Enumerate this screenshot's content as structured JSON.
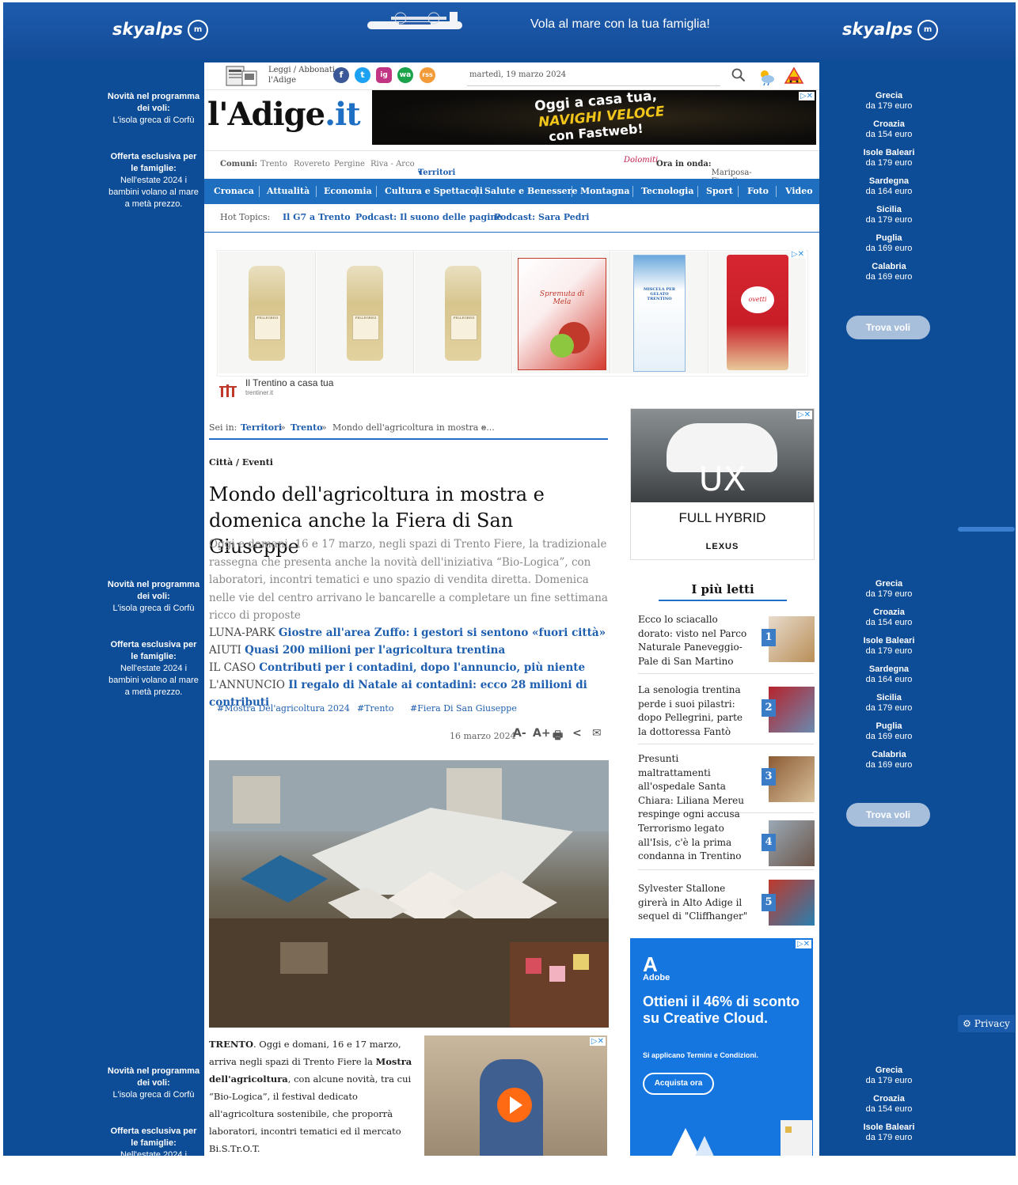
{
  "skin": {
    "brand": "skyalps",
    "slogan": "Vola al mare con la tua famiglia!",
    "left_blocks": [
      {
        "title": "Novità nel programma dei voli:",
        "text": "L'isola greca di Corfù"
      },
      {
        "title": "Offerta esclusiva per le famiglie:",
        "text": "Nell'estate 2024 i bambini volano al mare a metà prezzo."
      }
    ],
    "destinations": [
      {
        "name": "Grecia",
        "price": "da 179 euro"
      },
      {
        "name": "Croazia",
        "price": "da 154 euro"
      },
      {
        "name": "Isole Baleari",
        "price": "da 179 euro"
      },
      {
        "name": "Sardegna",
        "price": "da 164 euro"
      },
      {
        "name": "Sicilia",
        "price": "da 179 euro"
      },
      {
        "name": "Puglia",
        "price": "da 169 euro"
      },
      {
        "name": "Calabria",
        "price": "da 169 euro"
      }
    ],
    "cta": "Trova voli",
    "privacy": "Privacy"
  },
  "header": {
    "leggi": "Leggi / Abbonati",
    "leggi_sub": "l'Adige",
    "date": "martedì, 19 marzo 2024",
    "logo_main": "l'Adige",
    "logo_suffix": ".it",
    "social": [
      "f",
      "t",
      "ig",
      "wa",
      "rss"
    ]
  },
  "ad_top": {
    "line1": "Oggi a casa tua,",
    "line2": "NAVIGHI VELOCE",
    "line3": "con Fastweb!"
  },
  "comuni": {
    "label": "Comuni:",
    "items": [
      "Trento",
      "Rovereto",
      "Pergine",
      "Riva - Arco"
    ],
    "territori": "Territori",
    "radio_logo": "Dolomiti",
    "onda_label": "Ora in onda:",
    "onda_value": "Mariposa-Fiorella Mannoia"
  },
  "nav": [
    "Cronaca",
    "Attualità",
    "Economia",
    "Cultura e Spettacoli",
    "Salute e Benessere",
    "Montagna",
    "Tecnologia",
    "Sport",
    "Foto",
    "Video"
  ],
  "hot": {
    "label": "Hot Topics:",
    "items": [
      "Il G7 a Trento",
      "Podcast: Il suono delle pagine",
      "Podcast: Sara Pedri"
    ]
  },
  "products_ad": {
    "labels": [
      "PELLEGRINI",
      "PELLEGRINI",
      "PELLEGRINI",
      "Spremuta di Mela",
      "MISCELA PER GELATO TRENTINO",
      "ovetti"
    ],
    "sponsor": "Il Trentino a casa tua",
    "sponsor_url": "trentiner.it"
  },
  "breadcrumb": {
    "prefix": "Sei in:",
    "items": [
      "Territori",
      "Trento"
    ],
    "current": "Mondo dell'agricoltura in mostra e...",
    "sep": "»"
  },
  "article": {
    "section": "Città / Eventi",
    "title": "Mondo dell'agricoltura in mostra e domenica anche la Fiera di San Giuseppe",
    "summary": "Oggi e domani, 16 e 17 marzo, negli spazi di Trento Fiere, la tradizionale rassegna che presenta anche la novità dell'iniziativa “Bio-Logica”, con laboratori, incontri tematici e uno spazio di vendita diretta. Domenica nelle vie del centro arrivano le bancarelle a completare un fine settimana ricco di proposte",
    "related": [
      {
        "kicker": "LUNA-PARK",
        "link": "Giostre all'area Zuffo: i gestori si sentono «fuori città»"
      },
      {
        "kicker": "AIUTI",
        "link": "Quasi 200 milioni per l'agricoltura trentina"
      },
      {
        "kicker": "IL CASO",
        "link": "Contributi per i contadini, dopo l'annuncio, più niente"
      },
      {
        "kicker": "L'ANNUNCIO",
        "link": "Il regalo di Natale ai contadini: ecco 28 milioni di contributi"
      }
    ],
    "tags": [
      "#Mostra Del'agricoltura 2024",
      "#Trento",
      "#Fiera Di San Giuseppe"
    ],
    "date": "16 marzo 2024",
    "tools": [
      "A-",
      "A+"
    ],
    "body_city": "TRENTO",
    "body_1": ". Oggi e domani, 16 e 17 marzo, arriva negli spazi di Trento Fiere la ",
    "body_bold": "Mostra dell'agricoltura",
    "body_2": ", con alcune novità, tra cui “Bio-Logica”, il festival dedicato all'agricoltura sostenibile, che proporrà laboratori, incontri tematici ed il mercato Bi.S.Tr.O.T."
  },
  "ad_lexus": {
    "model": "UX",
    "tagline": "FULL HYBRID",
    "brand": "LEXUS"
  },
  "most_read": {
    "title": "I più letti",
    "items": [
      {
        "n": "1",
        "text": "Ecco lo sciacallo dorato: visto nel Parco Naturale Paneveggio-Pale di San Martino"
      },
      {
        "n": "2",
        "text": "La senologia trentina perde i suoi pilastri: dopo Pellegrini, parte la dottoressa Fantò"
      },
      {
        "n": "3",
        "text": "Presunti maltrattamenti all'ospedale Santa Chiara: Liliana Mereu respinge ogni accusa"
      },
      {
        "n": "4",
        "text": "Terrorismo legato all'Isis, c'è la prima condanna in Trentino"
      },
      {
        "n": "5",
        "text": "Sylvester Stallone girerà in Alto Adige il sequel di \"Cliffhanger\""
      }
    ]
  },
  "ad_adobe": {
    "brand": "Adobe",
    "headline": "Ottieni il 46% di sconto su Creative Cloud.",
    "small": "Si applicano Termini e Condizioni.",
    "cta": "Acquista ora"
  }
}
